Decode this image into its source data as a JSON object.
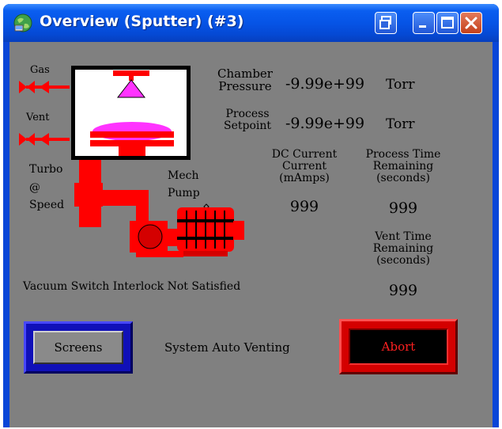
{
  "window": {
    "title": "Overview (Sputter) (#3)"
  },
  "diagram": {
    "gas_label": "Gas",
    "vent_label": "Vent",
    "turbo_label_line1": "Turbo",
    "turbo_label_line2": "@",
    "turbo_label_line3": "Speed",
    "mech_pump_line1": "Mech",
    "mech_pump_line2": "Pump"
  },
  "readouts": {
    "chamber_pressure_label_line1": "Chamber",
    "chamber_pressure_label_line2": "Pressure",
    "chamber_pressure_value": "-9.99e+99",
    "chamber_pressure_unit": "Torr",
    "process_setpoint_label_line1": "Process",
    "process_setpoint_label_line2": "Setpoint",
    "process_setpoint_value": "-9.99e+99",
    "process_setpoint_unit": "Torr",
    "dc_current_label_line1": "DC Current",
    "dc_current_label_line2": "Current",
    "dc_current_label_line3": "(mAmps)",
    "dc_current_value": "999",
    "process_time_label_line1": "Process Time",
    "process_time_label_line2": "Remaining",
    "process_time_label_line3": "(seconds)",
    "process_time_value": "999",
    "vent_time_label_line1": "Vent Time",
    "vent_time_label_line2": "Remaining",
    "vent_time_label_line3": "(seconds)",
    "vent_time_value": "999"
  },
  "status": {
    "interlock_message": "Vacuum Switch Interlock Not Satisfied",
    "system_status": "System Auto Venting"
  },
  "buttons": {
    "screens_label": "Screens",
    "abort_label": "Abort"
  },
  "colors": {
    "panel_bg": "#808080",
    "component_red": "#ff0000",
    "target_magenta": "#ff33ff",
    "abort_text": "#ff2020",
    "screens_frame": "#1010b8"
  }
}
